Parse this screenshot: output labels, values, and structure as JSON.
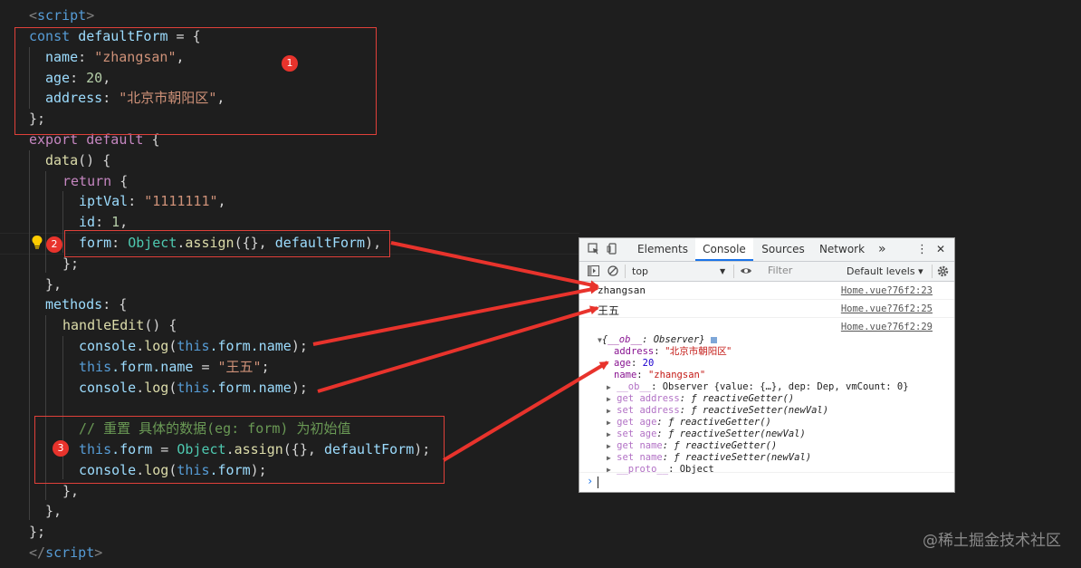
{
  "editor": {
    "lines": {
      "l0": {
        "tag_open": "<",
        "tag_name": "script",
        "tag_close": ">"
      },
      "l1": {
        "kw": "const",
        "name": "defaultForm",
        "rest": " = {"
      },
      "l2": {
        "key": "name",
        "colon": ": ",
        "value": "\"zhangsan\"",
        "end": ","
      },
      "l3": {
        "key": "age",
        "colon": ": ",
        "value": "20",
        "end": ","
      },
      "l4": {
        "key": "address",
        "colon": ": ",
        "value": "\"北京市朝阳区\"",
        "end": ","
      },
      "l5": {
        "text": "};"
      },
      "l6": {
        "kw1": "export",
        "kw2": "default",
        "rest": " {"
      },
      "l7": {
        "fn": "data",
        "rest": "() {"
      },
      "l8": {
        "kw": "return",
        "rest": " {"
      },
      "l9": {
        "key": "iptVal",
        "colon": ": ",
        "value": "\"1111111\"",
        "end": ","
      },
      "l10": {
        "key": "id",
        "colon": ": ",
        "value": "1",
        "end": ","
      },
      "l11": {
        "key": "form",
        "colon": ": ",
        "cls": "Object",
        "dot": ".",
        "fn": "assign",
        "args_open": "({}, ",
        "arg": "defaultForm",
        "end": "),"
      },
      "l12": {
        "text": "};"
      },
      "l13": {
        "text": "},"
      },
      "l14": {
        "key": "methods",
        "rest": ": {"
      },
      "l15": {
        "fn": "handleEdit",
        "rest": "() {"
      },
      "l16": {
        "obj": "console",
        "dot": ".",
        "fn": "log",
        "open": "(",
        "this": "this",
        "path": ".form.name",
        "close": ");"
      },
      "l17": {
        "this": "this",
        "path": ".form.name",
        "eq": " = ",
        "value": "\"王五\"",
        "end": ";"
      },
      "l18": {
        "obj": "console",
        "dot": ".",
        "fn": "log",
        "open": "(",
        "this": "this",
        "path": ".form.name",
        "close": ");"
      },
      "l20": {
        "comment": "// 重置 具体的数据(eg: form) 为初始值"
      },
      "l21": {
        "this": "this",
        "path": ".form",
        "eq": " = ",
        "cls": "Object",
        "dot": ".",
        "fn": "assign",
        "args_open": "({}, ",
        "arg": "defaultForm",
        "end": ");"
      },
      "l22": {
        "obj": "console",
        "dot": ".",
        "fn": "log",
        "open": "(",
        "this": "this",
        "path": ".form",
        "close": ");"
      },
      "l23": {
        "text": "},"
      },
      "l24": {
        "text": "},"
      },
      "l25": {
        "text": "};"
      },
      "l26": {
        "tag_open": "</",
        "tag_name": "script",
        "tag_close": ">"
      }
    },
    "badges": [
      "1",
      "2",
      "3"
    ],
    "accent": "#e8332c"
  },
  "devtools": {
    "tabs": [
      "Elements",
      "Console",
      "Sources",
      "Network"
    ],
    "active_tab": "Console",
    "more_tabs": "»",
    "menu": "⋮",
    "close": "✕",
    "context": "top",
    "filter_placeholder": "Filter",
    "levels": "Default levels ▾",
    "messages": [
      {
        "text": "zhangsan",
        "source": "Home.vue?76f2:23"
      },
      {
        "text": "王五",
        "source": "Home.vue?76f2:25"
      },
      {
        "text": "",
        "source": "Home.vue?76f2:29"
      }
    ],
    "object": {
      "summary_open": "{",
      "summary_key": "__ob__",
      "summary_rest": ": Observer}",
      "props": [
        {
          "key": "address",
          "value": "\"北京市朝阳区\""
        },
        {
          "key": "age",
          "value": "20"
        },
        {
          "key": "name",
          "value": "\"zhangsan\""
        }
      ],
      "expandable": [
        {
          "key": "__ob__",
          "rest": ": Observer {value: {…}, dep: Dep, vmCount: 0}"
        },
        {
          "key": "get address",
          "rest": ": ƒ reactiveGetter()"
        },
        {
          "key": "set address",
          "rest": ": ƒ reactiveSetter(newVal)"
        },
        {
          "key": "get age",
          "rest": ": ƒ reactiveGetter()"
        },
        {
          "key": "set age",
          "rest": ": ƒ reactiveSetter(newVal)"
        },
        {
          "key": "get name",
          "rest": ": ƒ reactiveGetter()"
        },
        {
          "key": "set name",
          "rest": ": ƒ reactiveSetter(newVal)"
        },
        {
          "key": "__proto__",
          "rest": ": Object"
        }
      ]
    },
    "prompt": "›"
  },
  "watermark": "@稀土掘金技术社区"
}
